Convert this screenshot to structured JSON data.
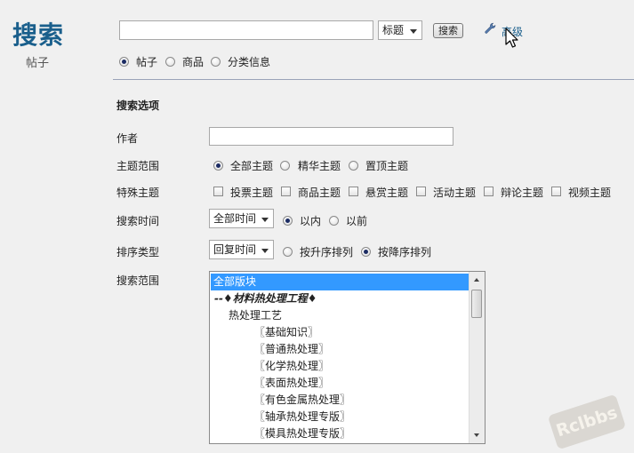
{
  "header": {
    "title": "搜索",
    "subtitle": "帖子"
  },
  "search_bar": {
    "query_value": "",
    "scope_select": "标题",
    "search_button": "搜索",
    "advanced_link": "高级"
  },
  "search_type": {
    "options": [
      "帖子",
      "商品",
      "分类信息"
    ],
    "selected": "帖子"
  },
  "options_section": {
    "heading": "搜索选项",
    "author": {
      "label": "作者",
      "value": ""
    },
    "topic_range": {
      "label": "主题范围",
      "options": [
        "全部主题",
        "精华主题",
        "置顶主题"
      ],
      "selected": "全部主题"
    },
    "special_topic": {
      "label": "特殊主题",
      "options": [
        "投票主题",
        "商品主题",
        "悬赏主题",
        "活动主题",
        "辩论主题",
        "视频主题"
      ]
    },
    "search_time": {
      "label": "搜索时间",
      "select_value": "全部时间",
      "options": [
        "以内",
        "以前"
      ],
      "selected": "以内"
    },
    "sort_type": {
      "label": "排序类型",
      "select_value": "回复时间",
      "options": [
        "按升序排列",
        "按降序排列"
      ],
      "selected": "按降序排列"
    },
    "search_scope": {
      "label": "搜索范围",
      "items": [
        "全部版块",
        "--♦材料热处理工程♦",
        "热处理工艺",
        "〖基础知识〗",
        "〖普通热处理〗",
        "〖化学热处理〗",
        "〖表面热处理〗",
        "〖有色金属热处理〗",
        "〖轴承热处理专版〗",
        "〖模具热处理专版〗"
      ],
      "selected_index": 0
    }
  },
  "watermark": "Rclbbs",
  "colors": {
    "title": "#1a5f8c",
    "selection": "#3399ff",
    "background": "#f0f0f0"
  }
}
